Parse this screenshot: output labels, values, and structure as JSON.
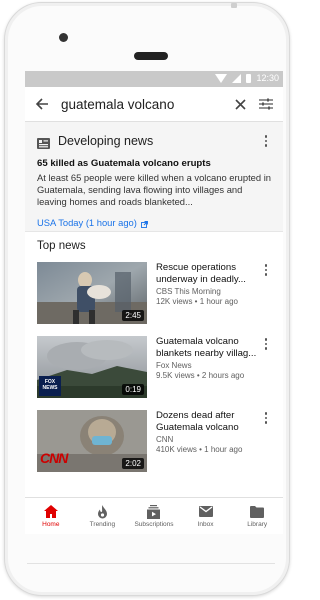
{
  "status": {
    "time": "12:30"
  },
  "search": {
    "query": "guatemala volcano"
  },
  "developing": {
    "title": "Developing news",
    "headline": "65 killed as Guatemala volcano erupts",
    "summary": "At least 65 people were killed when a volcano erupted in Guatemala, sending lava flowing into villages and leaving homes and roads blanketed...",
    "source": "USA Today (1 hour ago)"
  },
  "top_news": {
    "title": "Top news",
    "videos": [
      {
        "title": "Rescue operations underway in deadly...",
        "channel": "CBS This Morning",
        "meta": "12K views • 1 hour ago",
        "duration": "2:45",
        "logo": ""
      },
      {
        "title": "Guatemala volcano blankets nearby villag...",
        "channel": "Fox News",
        "meta": "9.5K views • 2 hours ago",
        "duration": "0:19",
        "logo": "FOX NEWS"
      },
      {
        "title": "Dozens dead after Guatemala volcano er...",
        "channel": "CNN",
        "meta": "410K views • 1 hour ago",
        "duration": "2:02",
        "logo": "CNN"
      }
    ]
  },
  "nav": {
    "items": [
      {
        "label": "Home",
        "icon": "home-icon",
        "active": true
      },
      {
        "label": "Trending",
        "icon": "flame-icon",
        "active": false
      },
      {
        "label": "Subscriptions",
        "icon": "subscriptions-icon",
        "active": false
      },
      {
        "label": "Inbox",
        "icon": "inbox-icon",
        "active": false
      },
      {
        "label": "Library",
        "icon": "folder-icon",
        "active": false
      }
    ]
  },
  "colors": {
    "accent": "#e00000",
    "link": "#1a73e8",
    "status_bar": "#c9c9c9"
  }
}
